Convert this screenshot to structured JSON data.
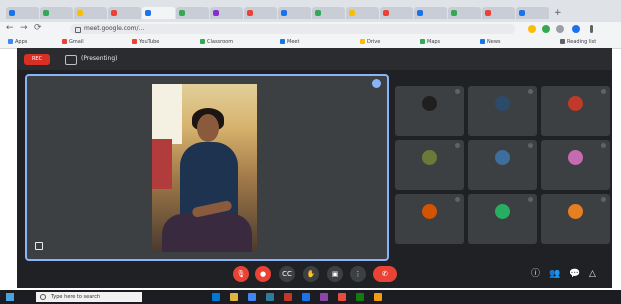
{
  "browser": {
    "tab_colors": [
      "#1a73e8",
      "#34a853",
      "#fbbc04",
      "#ea4335",
      "#1a73e8",
      "#34a853",
      "#8430ce",
      "#ea4335",
      "#1a73e8",
      "#34a853",
      "#fbbc04",
      "#ea4335",
      "#1a73e8",
      "#34a853",
      "#ea4335",
      "#1a73e8"
    ],
    "new_tab_glyph": "+",
    "address": "meet.google.com/...",
    "nav_back": "←",
    "nav_forward": "→",
    "nav_reload": "⟳",
    "bookmarks": [
      {
        "label": "Apps",
        "color": "#4285f4"
      },
      {
        "label": "Gmail",
        "color": "#ea4335"
      },
      {
        "label": "YouTube",
        "color": "#ea4335"
      },
      {
        "label": "Classroom",
        "color": "#34a853"
      },
      {
        "label": "Meet",
        "color": "#1a73e8"
      },
      {
        "label": "Drive",
        "color": "#fbbc04"
      },
      {
        "label": "Maps",
        "color": "#34a853"
      },
      {
        "label": "News",
        "color": "#1a73e8"
      },
      {
        "label": "Reading list",
        "color": "#5f6368"
      }
    ]
  },
  "meet": {
    "rec_label": "REC",
    "presenter_label": "(Presenting)",
    "main_name": "",
    "participants": [
      {
        "name": "",
        "avatar_color": "#1f1f1f"
      },
      {
        "name": "",
        "avatar_color": "#2b4b6b"
      },
      {
        "name": "",
        "avatar_color": "#c0392b"
      },
      {
        "name": "",
        "avatar_color": "#6b7a3a"
      },
      {
        "name": "",
        "avatar_color": "#3d6e9e"
      },
      {
        "name": "",
        "avatar_color": "#c46bb2"
      },
      {
        "name": "",
        "avatar_color": "#d35400"
      },
      {
        "name": "",
        "avatar_color": "#27ae60"
      },
      {
        "name": "",
        "avatar_color": "#e67e22"
      }
    ],
    "time": "",
    "meeting_code": "",
    "controls": {
      "mic": "🎙",
      "camera": "●",
      "captions": "CC",
      "raise_hand": "✋",
      "present": "▣",
      "more": "⋮",
      "end_call": "✆"
    },
    "right_icons": [
      "ⓘ",
      "👥",
      "💬",
      "△"
    ]
  },
  "taskbar": {
    "search_placeholder": "Type here to search",
    "app_colors": [
      "#0078d4",
      "#e3b341",
      "#4285f4",
      "#2d7d9a",
      "#c0392b",
      "#1a73e8",
      "#8e44ad",
      "#e74c3c",
      "#107c10",
      "#f39c12"
    ],
    "tray_text": ""
  }
}
